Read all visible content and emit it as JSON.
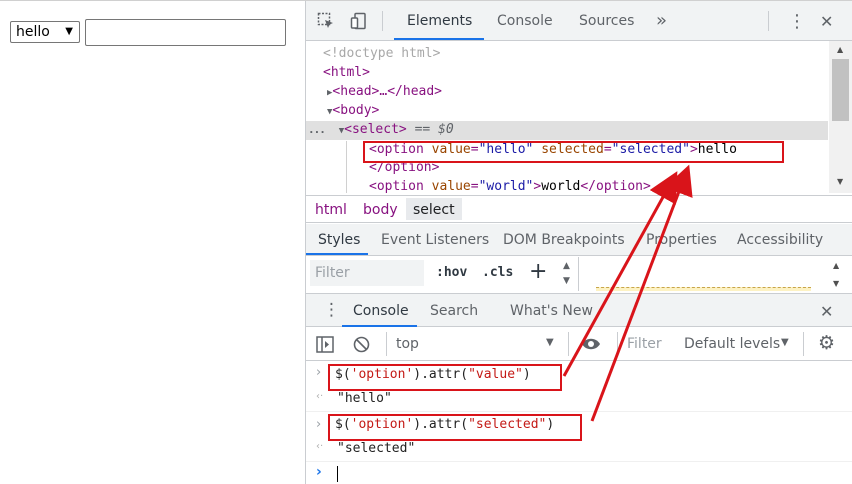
{
  "page": {
    "select_value": "hello",
    "select_caret": "▼",
    "text_input_value": ""
  },
  "devtools": {
    "toolbar": {
      "tabs": [
        "Elements",
        "Console",
        "Sources"
      ],
      "more_glyph": "»",
      "menu_glyph": "⋮",
      "close_glyph": "✕"
    },
    "elements": {
      "lines": [
        {
          "text": "<!doctype html>"
        },
        {
          "text": "<html>"
        },
        {
          "text": "<head>…</head>"
        },
        {
          "text": "<body>"
        },
        {
          "text": "<select> == $0"
        },
        {
          "text": "<option value=\"hello\" selected=\"selected\">hello"
        },
        {
          "text": "</option>"
        },
        {
          "text": "<option value=\"world\">world</option>"
        }
      ],
      "dom_pieces": {
        "doctype": "<!doctype html>",
        "html_open": "<html>",
        "head": "<head>…</head>",
        "body_open": "<body>",
        "select_open": "<select>",
        "select_marker": "== $0",
        "opt1_open": "<option ",
        "opt1_attr1_name": "value",
        "opt1_attr1_value": "\"hello\"",
        "opt1_attr2_name": "selected",
        "opt1_attr2_value": "\"selected\"",
        "opt1_close_bracket": ">",
        "opt1_text": "hello",
        "opt1_end": "</option>",
        "opt2_open": "<option ",
        "opt2_attr_name": "value",
        "opt2_attr_value": "\"world\"",
        "opt2_text": "world",
        "opt2_end": "</option>",
        "ellipsis_dots": "..."
      },
      "breadcrumb": [
        "html",
        "body",
        "select"
      ]
    },
    "styles_panel": {
      "tabs": [
        "Styles",
        "Event Listeners",
        "DOM Breakpoints",
        "Properties",
        "Accessibility"
      ],
      "filter_placeholder": "Filter",
      "hov_label": ":hov",
      "cls_label": ".cls",
      "plus_glyph": "+"
    },
    "drawer": {
      "tabs": [
        "Console",
        "Search",
        "What's New"
      ],
      "context": "top",
      "filter_placeholder": "Filter",
      "levels_label": "Default levels"
    },
    "console": {
      "entries": [
        {
          "input_prefix": "$(",
          "input_str": "'option'",
          "input_mid": ").attr(",
          "input_arg": "\"value\"",
          "input_suffix": ")",
          "output": "\"hello\""
        },
        {
          "input_prefix": "$(",
          "input_str": "'option'",
          "input_mid": ").attr(",
          "input_arg": "\"selected\"",
          "input_suffix": ")",
          "output": "\"selected\""
        }
      ],
      "prompt_glyph": "›",
      "result_glyph": "‹·"
    }
  }
}
